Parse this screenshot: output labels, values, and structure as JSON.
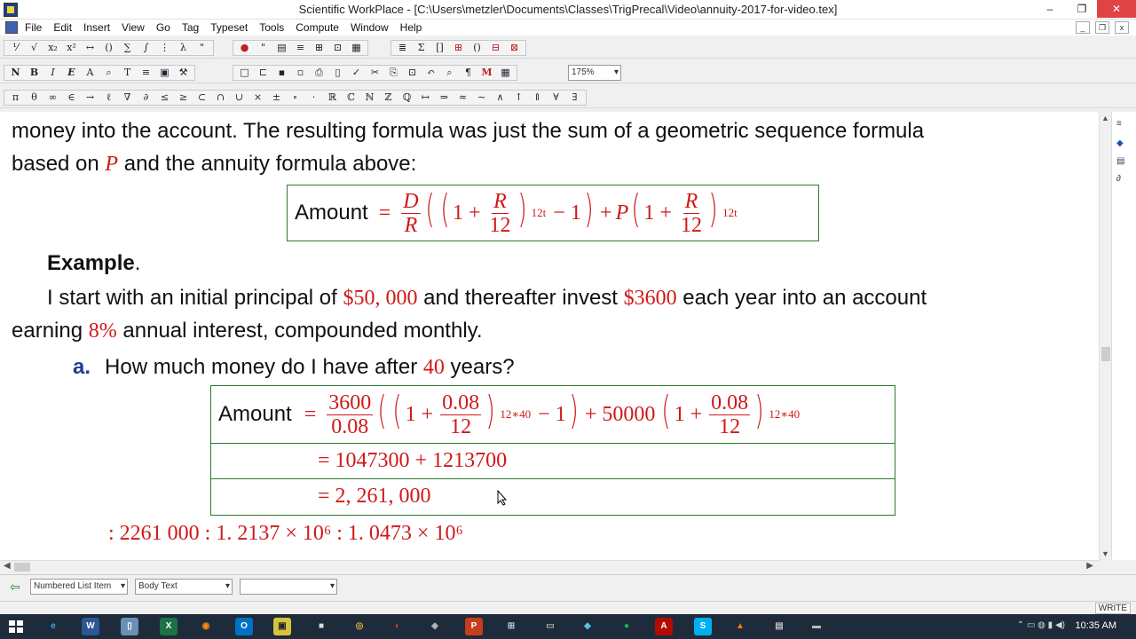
{
  "window": {
    "title": "Scientific WorkPlace - [C:\\Users\\metzler\\Documents\\Classes\\TrigPrecal\\Video\\annuity-2017-for-video.tex]",
    "controls": [
      "–",
      "❐",
      "✕"
    ]
  },
  "menu": {
    "items": [
      "File",
      "Edit",
      "Insert",
      "View",
      "Go",
      "Tag",
      "Typeset",
      "Tools",
      "Compute",
      "Window",
      "Help"
    ]
  },
  "toolbar": {
    "zoom": "175%",
    "format_buttons": [
      "N",
      "B",
      "I",
      "E"
    ]
  },
  "document": {
    "line1": "money into the account. The resulting formula was just the sum of a geometric sequence formula",
    "line2_pre": "based on ",
    "line2_var": "P",
    "line2_post": " and the annuity formula above:",
    "formula1": {
      "lhs": "Amount",
      "eq": "=",
      "D": "D",
      "R": "R",
      "one": "1",
      "plus": "+",
      "twelve": "12",
      "exp": "12t",
      "minus_one": "− 1",
      "P": "P"
    },
    "example_label": "Example",
    "example_period": ".",
    "ex_line1_a": "I start with an initial principal of ",
    "ex_principal": "$50, 000",
    "ex_line1_b": " and thereafter invest ",
    "ex_payment": "$3600",
    "ex_line1_c": " each year into an account",
    "ex_line2_a": "earning ",
    "ex_rate": "8%",
    "ex_line2_b": " annual interest, compounded monthly.",
    "part_a_label": "a.",
    "part_a_text_a": "How much money do I have after ",
    "part_a_years": "40",
    "part_a_text_b": " years?",
    "calc": {
      "lhs": "Amount",
      "eq": "=",
      "num": "3600",
      "den": "0.08",
      "rate": "0.08",
      "twelve": "12",
      "exp": "12∗40",
      "minus_one": "− 1",
      "principal": "+ 50000",
      "row2": "= 1047300 + 1213700",
      "row3": "= 2, 261, 000"
    },
    "result_line": ": 2261 000  :  1. 2137 × 10⁶  :  1. 0473 × 10⁶"
  },
  "status": {
    "item_tag": "Numbered List Item",
    "text_tag": "Body Text",
    "third": "",
    "mode": "WRITE"
  },
  "taskbar": {
    "time": "10:35 AM"
  }
}
